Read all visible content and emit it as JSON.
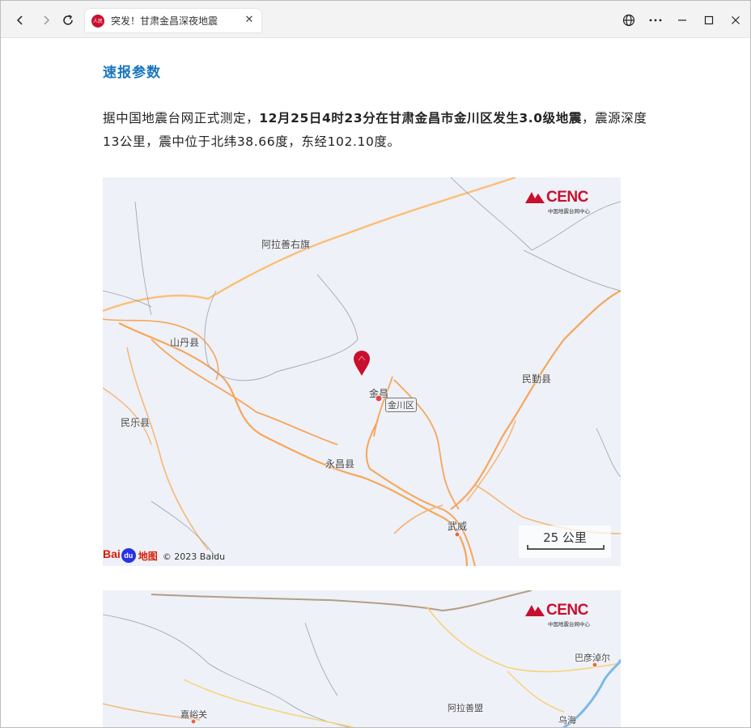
{
  "browser": {
    "tab_title": "突发！甘肃金昌深夜地震",
    "favicon_text": "人民",
    "close_glyph": "✕"
  },
  "article": {
    "section_title": "速报参数",
    "para_lead": "据中国地震台网正式测定，",
    "para_bold": "12月25日4时23分在甘肃金昌市金川区发生3.0级地震",
    "para_rest": "，震源深度13公里，震中位于北纬38.66度，东经102.10度。"
  },
  "map1": {
    "logo_text": "CENC",
    "logo_sub": "中国地震台网中心",
    "places": {
      "alashan_right": "阿拉善右旗",
      "shandan": "山丹县",
      "minle": "民乐县",
      "jinchang": "金昌",
      "jinchuan": "金川区",
      "yongchang": "永昌县",
      "minqin": "民勤县",
      "wuwei": "武威"
    },
    "scale_label": "25 公里",
    "baidu_left": "Bai",
    "baidu_du": "du",
    "baidu_ditu": "地图",
    "copyright": "© 2023 Baidu"
  },
  "map2": {
    "logo_text": "CENC",
    "logo_sub": "中国地震台网中心",
    "places": {
      "bayannur": "巴彦淖尔",
      "jiayuguan": "嘉峪关",
      "alashan": "阿拉善盟",
      "wuhai": "乌海"
    }
  }
}
